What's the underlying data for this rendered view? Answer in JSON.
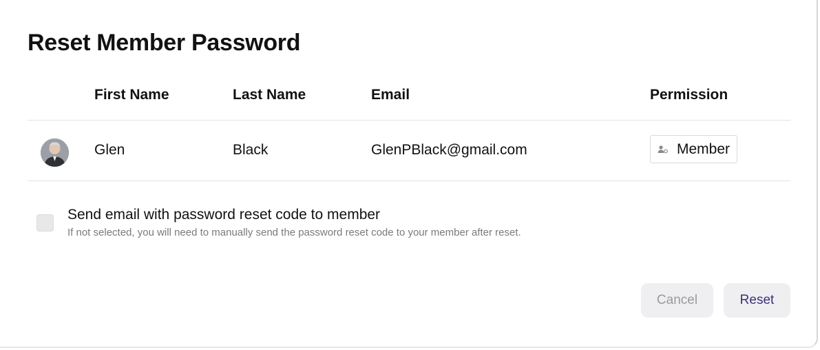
{
  "dialog": {
    "title": "Reset Member Password"
  },
  "table": {
    "headers": {
      "first_name": "First Name",
      "last_name": "Last Name",
      "email": "Email",
      "permission": "Permission"
    },
    "rows": [
      {
        "first_name": "Glen",
        "last_name": "Black",
        "email": "GlenPBlack@gmail.com",
        "permission": "Member",
        "permission_icon": "member-user-icon",
        "avatar": "avatar-photo"
      }
    ]
  },
  "send_email": {
    "checked": false,
    "label": "Send email with password reset code to member",
    "help": "If not selected, you will need to manually send the password reset code to your member after reset."
  },
  "actions": {
    "cancel_label": "Cancel",
    "reset_label": "Reset"
  },
  "colors": {
    "reset_text": "#3b2f7a",
    "cancel_text": "#9a9a9a",
    "button_bg": "#efeff2",
    "divider": "#e3e3e3"
  }
}
